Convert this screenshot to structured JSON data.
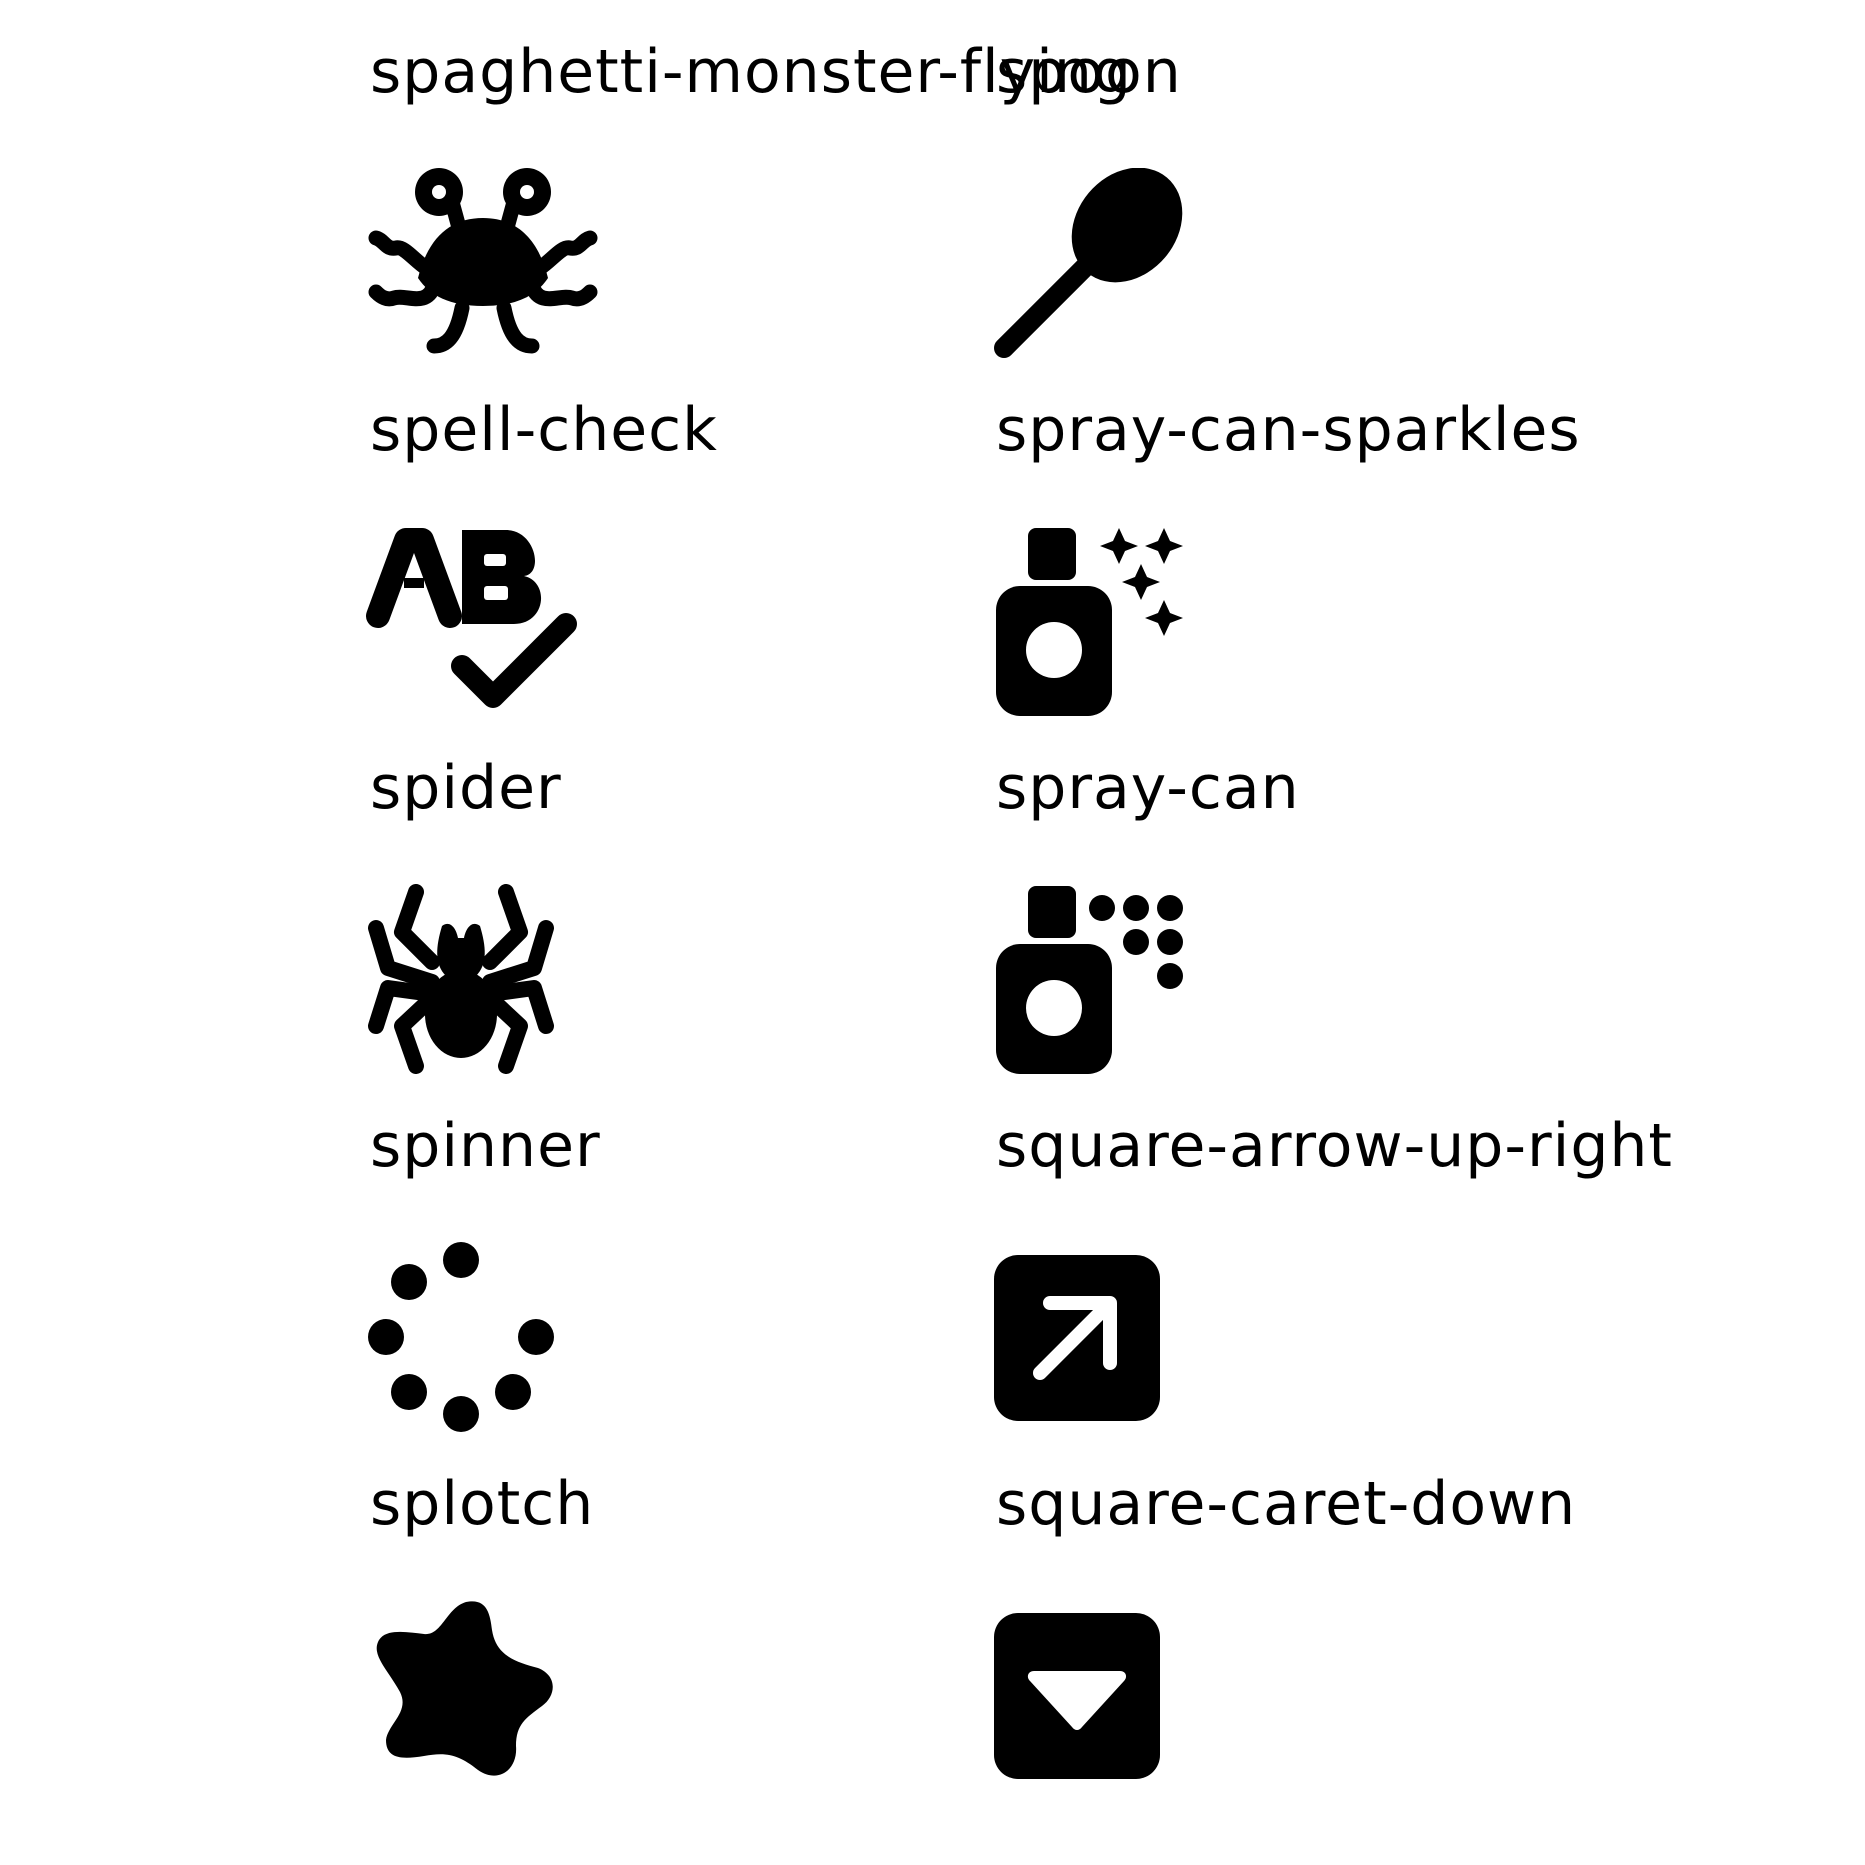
{
  "icons": [
    {
      "label": "spaghetti-monster-flying",
      "icon": "spaghetti-monster-flying-icon"
    },
    {
      "label": "spoon",
      "icon": "spoon-icon"
    },
    {
      "label": "spell-check",
      "icon": "spell-check-icon"
    },
    {
      "label": "spray-can-sparkles",
      "icon": "spray-can-sparkles-icon"
    },
    {
      "label": "spider",
      "icon": "spider-icon"
    },
    {
      "label": "spray-can",
      "icon": "spray-can-icon"
    },
    {
      "label": "spinner",
      "icon": "spinner-icon"
    },
    {
      "label": "square-arrow-up-right",
      "icon": "square-arrow-up-right-icon"
    },
    {
      "label": "splotch",
      "icon": "splotch-icon"
    },
    {
      "label": "square-caret-down",
      "icon": "square-caret-down-icon"
    }
  ],
  "colors": {
    "foreground": "#000000",
    "background": "#ffffff"
  }
}
